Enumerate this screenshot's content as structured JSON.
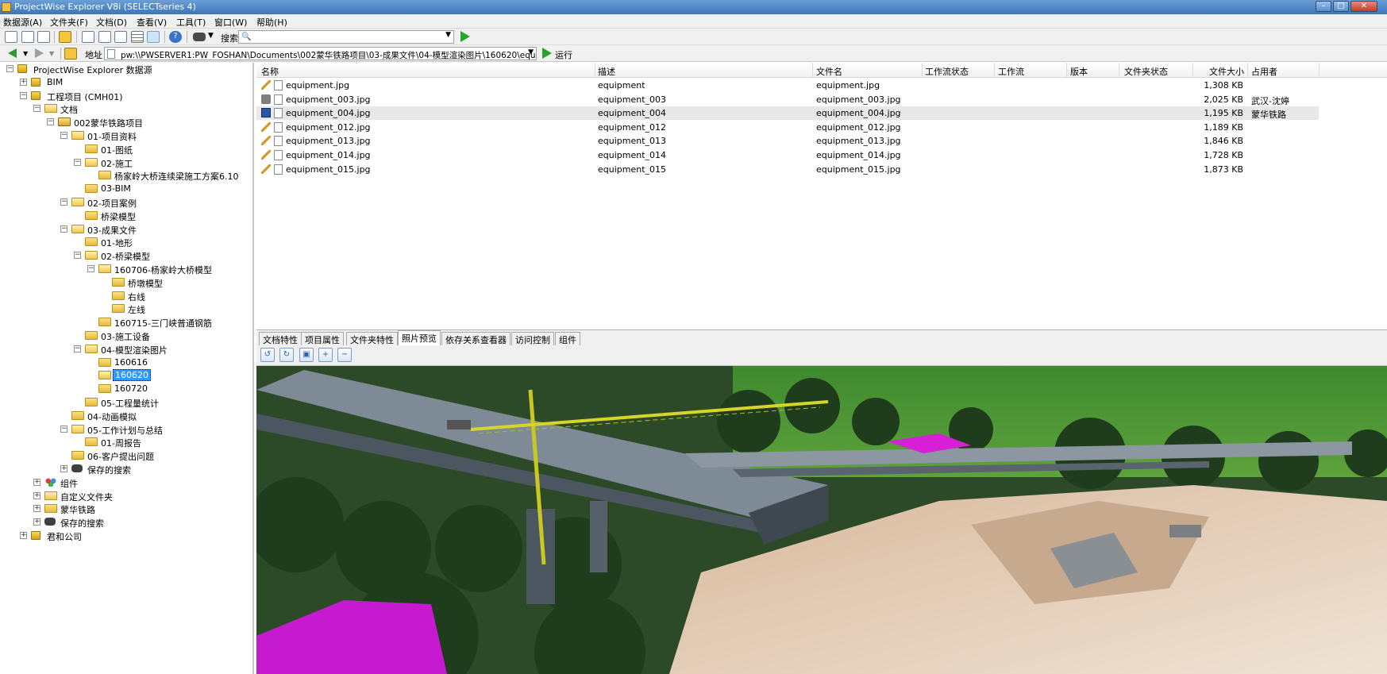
{
  "window": {
    "title": "ProjectWise Explorer V8i (SELECTseries 4)"
  },
  "menu": [
    "数据源(A)",
    "文件夹(F)",
    "文档(D)",
    "查看(V)",
    "工具(T)",
    "窗口(W)",
    "帮助(H)"
  ],
  "toolbar": {
    "search_label": "搜索",
    "run_label": "运行",
    "address_label": "地址"
  },
  "address": {
    "value": "pw:\\\\PWSERVER1:PW_FOSHAN\\Documents\\002蒙华铁路项目\\03-成果文件\\04-模型渲染图片\\160620\\equipm"
  },
  "tree": [
    {
      "label": "ProjectWise Explorer 数据源",
      "level": 0,
      "icon": "db",
      "exp": "-"
    },
    {
      "label": "BIM",
      "level": 1,
      "icon": "db",
      "exp": "+"
    },
    {
      "label": "工程项目 (CMH01)",
      "level": 1,
      "icon": "db",
      "exp": "-"
    },
    {
      "label": "文档",
      "level": 2,
      "icon": "openfolder",
      "exp": "-"
    },
    {
      "label": "002蒙华铁路项目",
      "level": 3,
      "icon": "proj",
      "exp": "-"
    },
    {
      "label": "01-项目资料",
      "level": 4,
      "icon": "openfolder",
      "exp": "-"
    },
    {
      "label": "01-图纸",
      "level": 5,
      "icon": "folder",
      "exp": ""
    },
    {
      "label": "02-施工",
      "level": 5,
      "icon": "openfolder",
      "exp": "-"
    },
    {
      "label": "杨家岭大桥连续梁施工方案6.10",
      "level": 6,
      "icon": "folder",
      "exp": ""
    },
    {
      "label": "03-BIM",
      "level": 5,
      "icon": "folder",
      "exp": ""
    },
    {
      "label": "02-项目案例",
      "level": 4,
      "icon": "openfolder",
      "exp": "-"
    },
    {
      "label": "桥梁模型",
      "level": 5,
      "icon": "folder",
      "exp": ""
    },
    {
      "label": "03-成果文件",
      "level": 4,
      "icon": "openfolder",
      "exp": "-"
    },
    {
      "label": "01-地形",
      "level": 5,
      "icon": "folder",
      "exp": ""
    },
    {
      "label": "02-桥梁模型",
      "level": 5,
      "icon": "openfolder",
      "exp": "-"
    },
    {
      "label": "160706-杨家岭大桥模型",
      "level": 6,
      "icon": "openfolder",
      "exp": "-"
    },
    {
      "label": "桥墩模型",
      "level": 7,
      "icon": "folder",
      "exp": ""
    },
    {
      "label": "右线",
      "level": 7,
      "icon": "folder",
      "exp": ""
    },
    {
      "label": "左线",
      "level": 7,
      "icon": "folder",
      "exp": ""
    },
    {
      "label": "160715-三门峡普通钢筋",
      "level": 6,
      "icon": "folder",
      "exp": ""
    },
    {
      "label": "03-施工设备",
      "level": 5,
      "icon": "folder",
      "exp": ""
    },
    {
      "label": "04-模型渲染图片",
      "level": 5,
      "icon": "openfolder",
      "exp": "-"
    },
    {
      "label": "160616",
      "level": 6,
      "icon": "folder",
      "exp": ""
    },
    {
      "label": "160620",
      "level": 6,
      "icon": "openfolder",
      "exp": "",
      "selected": true
    },
    {
      "label": "160720",
      "level": 6,
      "icon": "folder",
      "exp": ""
    },
    {
      "label": "05-工程量统计",
      "level": 5,
      "icon": "folder",
      "exp": ""
    },
    {
      "label": "04-动画模拟",
      "level": 4,
      "icon": "folder",
      "exp": ""
    },
    {
      "label": "05-工作计划与总结",
      "level": 4,
      "icon": "openfolder",
      "exp": "-"
    },
    {
      "label": "01-周报告",
      "level": 5,
      "icon": "folder",
      "exp": ""
    },
    {
      "label": "06-客户提出问题",
      "level": 4,
      "icon": "folder",
      "exp": ""
    },
    {
      "label": "保存的搜索",
      "level": 4,
      "icon": "binoc",
      "exp": "+"
    },
    {
      "label": "组件",
      "level": 2,
      "icon": "comp",
      "exp": "+"
    },
    {
      "label": "自定义文件夹",
      "level": 2,
      "icon": "openfolder",
      "exp": "+"
    },
    {
      "label": "蒙华铁路",
      "level": 2,
      "icon": "folder",
      "exp": "+"
    },
    {
      "label": "保存的搜索",
      "level": 2,
      "icon": "binoc",
      "exp": "+"
    },
    {
      "label": "君和公司",
      "level": 1,
      "icon": "db",
      "exp": "+"
    }
  ],
  "list": {
    "columns": [
      "名称",
      "描述",
      "文件名",
      "工作流状态",
      "工作流",
      "版本",
      "文件夹状态",
      "文件大小",
      "占用者"
    ],
    "rows": [
      {
        "name": "equipment.jpg",
        "desc": "equipment",
        "file": "equipment.jpg",
        "size": "1,308 KB",
        "owner": "",
        "status": "pencil"
      },
      {
        "name": "equipment_003.jpg",
        "desc": "equipment_003",
        "file": "equipment_003.jpg",
        "size": "2,025 KB",
        "owner": "武汉-沈婷",
        "status": "lock"
      },
      {
        "name": "equipment_004.jpg",
        "desc": "equipment_004",
        "file": "equipment_004.jpg",
        "size": "1,195 KB",
        "owner": "蒙华铁路",
        "status": "save",
        "highlight": true
      },
      {
        "name": "equipment_012.jpg",
        "desc": "equipment_012",
        "file": "equipment_012.jpg",
        "size": "1,189 KB",
        "owner": "",
        "status": "pencil"
      },
      {
        "name": "equipment_013.jpg",
        "desc": "equipment_013",
        "file": "equipment_013.jpg",
        "size": "1,846 KB",
        "owner": "",
        "status": "pencil"
      },
      {
        "name": "equipment_014.jpg",
        "desc": "equipment_014",
        "file": "equipment_014.jpg",
        "size": "1,728 KB",
        "owner": "",
        "status": "pencil"
      },
      {
        "name": "equipment_015.jpg",
        "desc": "equipment_015",
        "file": "equipment_015.jpg",
        "size": "1,873 KB",
        "owner": "",
        "status": "pencil"
      }
    ]
  },
  "tabs": [
    "文档特性",
    "项目属性",
    "文件夹特性",
    "照片预览",
    "依存关系查看器",
    "访问控制",
    "组件"
  ],
  "active_tab": "照片预览",
  "colors": {
    "selection": "#3399ff",
    "title_bar": "#3c75b8",
    "run_green": "#27a52a"
  }
}
